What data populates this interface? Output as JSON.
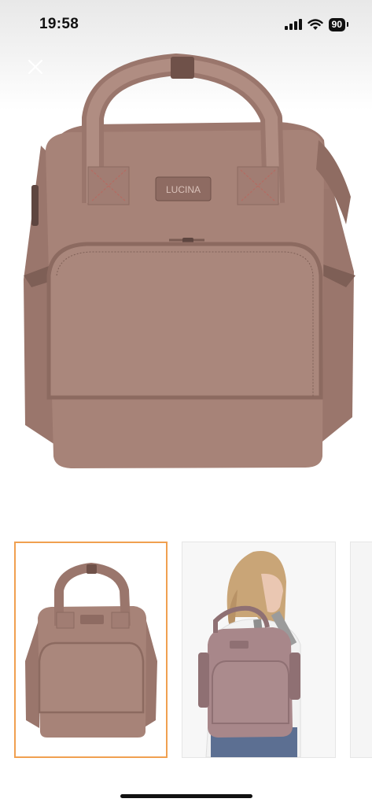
{
  "status_bar": {
    "time": "19:58",
    "battery_level": "90",
    "icons": [
      "signal-icon",
      "wifi-icon",
      "battery-icon"
    ]
  },
  "close_button": {
    "icon": "close-icon"
  },
  "product_image": {
    "brand_label": "LUCINA",
    "bag_color": "#a78378"
  },
  "thumbnails": [
    {
      "name": "thumbnail-bag-front",
      "selected": true
    },
    {
      "name": "thumbnail-model-wearing",
      "selected": false
    },
    {
      "name": "thumbnail-partial",
      "selected": false
    }
  ],
  "colors": {
    "selected_border": "#f0a050",
    "bag": "#a78378",
    "bag_dark": "#8c6a60"
  }
}
